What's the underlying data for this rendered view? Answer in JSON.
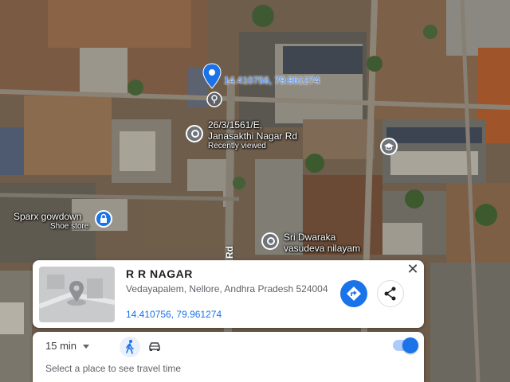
{
  "map": {
    "dropped_pin_coords": "14.410756, 79.961274",
    "places": [
      {
        "name": "26/3/1561/E,",
        "line2": "Janasakthi Nagar Rd",
        "note": "Recently viewed"
      },
      {
        "name": "Sparx gowdown",
        "note": "Shoe store"
      },
      {
        "name": "Sri Dwaraka",
        "line2": "vasudeva nilayam"
      }
    ],
    "road_label": "Rd"
  },
  "place_card": {
    "title": "R R NAGAR",
    "address": "Vedayapalem, Nellore, Andhra Pradesh 524004",
    "coords": "14.410756, 79.961274",
    "close_glyph": "✕",
    "directions_icon": "directions-icon",
    "share_icon": "share-icon"
  },
  "travel_bar": {
    "time": "15 min",
    "hint": "Select a place to see travel time",
    "modes": [
      "walk-icon",
      "car-icon"
    ],
    "toggle_on": true
  },
  "colors": {
    "accent": "#1a73e8",
    "pin_blue": "#1a73e8",
    "pin_gray": "#6f7479"
  }
}
